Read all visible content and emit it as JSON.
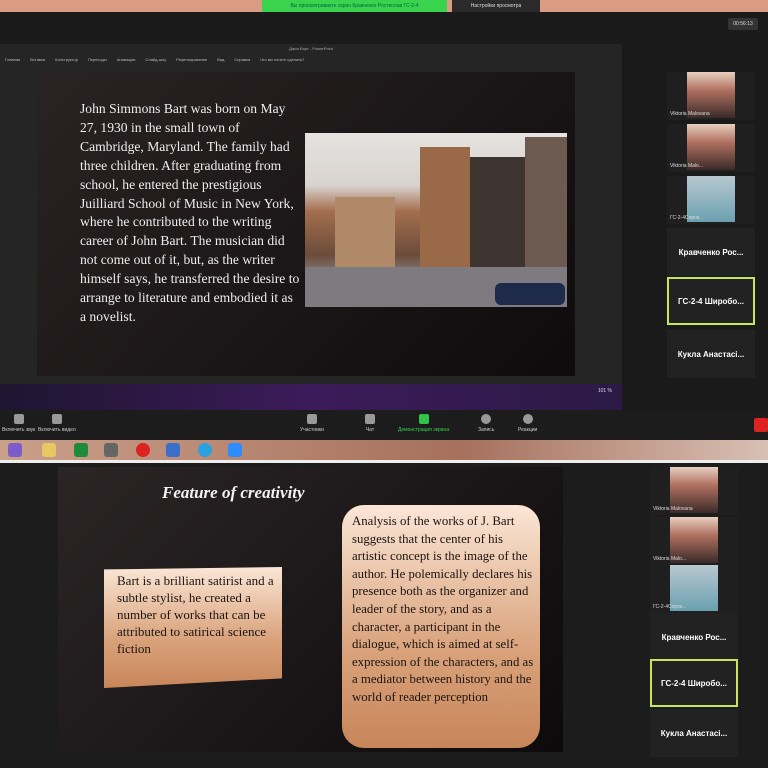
{
  "top": {
    "viewing_banner": "Вы просматриваете экран Кравченко Ростислав ГС-2-4",
    "view_options": "Настройки просмотра",
    "timer": "00:56:13",
    "ppt_title": "Джон Барт - PowerPoint",
    "ppt_menu": [
      "Главная",
      "Вставка",
      "Конструктор",
      "Переходы",
      "Анимация",
      "Слайд-шоу",
      "Рецензирование",
      "Вид",
      "Справка",
      "Что вы хотите сделать?"
    ],
    "slide_text": "John Simmons Bart was born on May 27, 1930 in the small town of Cambridge, Maryland. The family had three children. After graduating from school, he entered the prestigious Juilliard School of Music in New York, where he contributed to the writing career of John Bart. The musician did not come out of it, but, as the writer himself says, he transferred the desire to arrange to literature and embodied it as a novelist.",
    "zoom_toolbar": {
      "audio": "Включить звук",
      "video": "Включить видео",
      "participants": "Участники",
      "chat": "Чат",
      "share": "Демонстрация экрана",
      "record": "Запись",
      "reactions": "Реакции"
    },
    "zoom_level": "101 %"
  },
  "bottom": {
    "title": "Feature of creativity",
    "left_box": "Bart is a brilliant satirist and a subtle stylist, he created a number of works that can be attributed to satirical science fiction",
    "right_box": "Analysis of the works of J. Bart suggests that the center of his artistic concept is the image of the author. He polemically declares his presence both as the organizer and leader of the story, and as a character, a participant in the dialogue, which is aimed at self-expression of the characters, and as a mediator between history and the world of reader perception"
  },
  "participants": [
    {
      "name": "Viktoria Malovana"
    },
    {
      "name": "Viktoria Malo..."
    },
    {
      "name": "ГС-2-4Сорок..."
    },
    {
      "name": "Кравченко Рос..."
    },
    {
      "name": "ГС-2-4 Широбо..."
    },
    {
      "name": "Кукла Анастасі..."
    }
  ],
  "colors": {
    "active_border": "#c7e55a",
    "banner_green": "#3ad34e"
  }
}
